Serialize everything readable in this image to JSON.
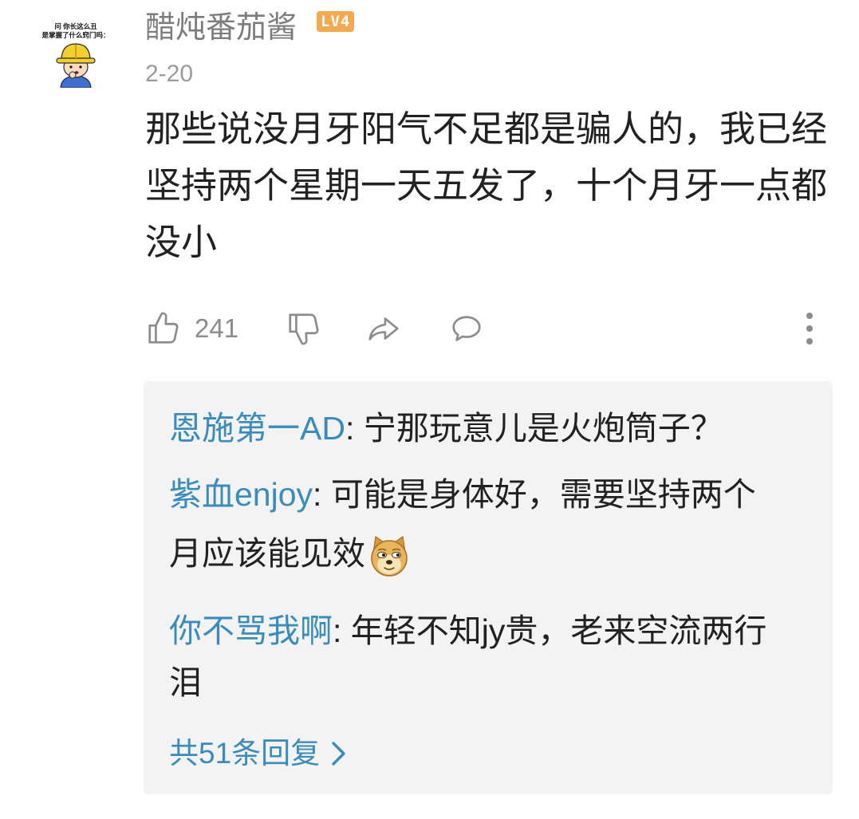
{
  "comment": {
    "avatar": {
      "icon": "avatar-hard-hat-cartoon",
      "caption_lines": [
        "问 你长这么丑",
        "是掌握了什么窍门吗："
      ]
    },
    "username": "醋炖番茄酱",
    "level": "LV4",
    "date": "2-20",
    "text": "那些说没月牙阳气不足都是骗人的，我已经坚持两个星期一天五发了，十个月牙一点都没小",
    "like_count": "241",
    "icons": {
      "like": "thumbs-up-icon",
      "dislike": "thumbs-down-icon",
      "share": "share-icon",
      "reply": "comment-icon",
      "more": "more-vertical-icon"
    }
  },
  "replies": {
    "items": [
      {
        "user": "恩施第一AD",
        "separator": ": ",
        "text": "宁那玩意儿是火炮筒子？"
      },
      {
        "user": "紫血enjoy",
        "separator": ": ",
        "text": "可能是身体好，需要坚持两个月应该能见效",
        "emoji": "doge-emoji-icon"
      },
      {
        "user": "你不骂我啊",
        "separator": ": ",
        "text": "年轻不知jy贵，老来空流两行泪"
      }
    ],
    "more_label": "共51条回复",
    "more_icon": "chevron-right-icon"
  },
  "colors": {
    "username": "#7c7c7c",
    "date": "#9b9b9b",
    "text": "#212121",
    "level_badge": "#f5a84c",
    "icon": "#8c8c8c",
    "reply_user": "#3a8cbd",
    "reply_box": "#f3f3f3"
  }
}
